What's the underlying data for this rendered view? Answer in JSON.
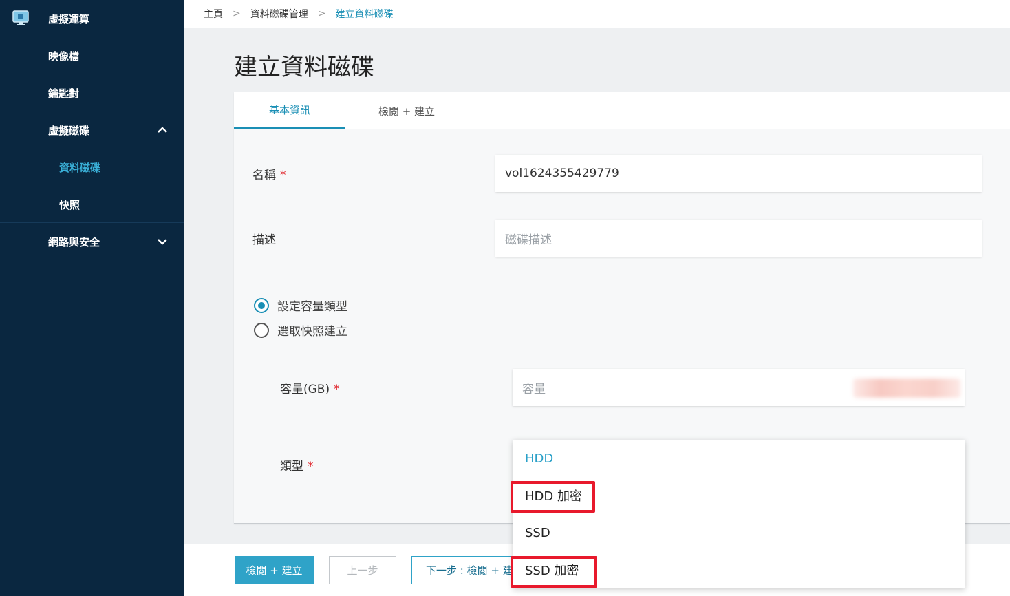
{
  "sidebar": {
    "items": [
      {
        "label": "虛擬運算"
      },
      {
        "label": "映像檔"
      },
      {
        "label": "鑰匙對"
      },
      {
        "label": "虛擬磁碟"
      },
      {
        "label": "資料磁碟"
      },
      {
        "label": "快照"
      },
      {
        "label": "網路與安全"
      }
    ],
    "active_color": "#3ab0d8",
    "background": "#0a2740"
  },
  "breadcrumb": {
    "items": [
      "主頁",
      "資料磁碟管理",
      "建立資料磁碟"
    ],
    "separator": ">"
  },
  "page": {
    "title": "建立資料磁碟"
  },
  "tabs": [
    {
      "label": "基本資訊",
      "active": true
    },
    {
      "label": "檢閱 + 建立",
      "active": false
    }
  ],
  "form": {
    "name_label": "名稱",
    "name_value": "vol1624355429779",
    "description_label": "描述",
    "description_placeholder": "磁碟描述",
    "required_mark": "*",
    "radio_options": [
      {
        "label": "設定容量類型",
        "checked": true
      },
      {
        "label": "選取快照建立",
        "checked": false
      }
    ],
    "capacity_label": "容量(GB)",
    "capacity_placeholder": "容量",
    "type_label": "類型"
  },
  "dropdown": {
    "options": [
      "HDD",
      "HDD 加密",
      "SSD",
      "SSD 加密"
    ],
    "selected": "HDD",
    "highlighted": [
      "HDD 加密",
      "SSD 加密"
    ]
  },
  "buttons": {
    "review_create": "檢閱 + 建立",
    "previous": "上一步",
    "next": "下一步 : 檢閱 + 建立"
  },
  "colors": {
    "accent": "#1a8fb5",
    "primary_button": "#2fa3c8",
    "highlight": "#e8192c",
    "required": "#e0262d"
  }
}
